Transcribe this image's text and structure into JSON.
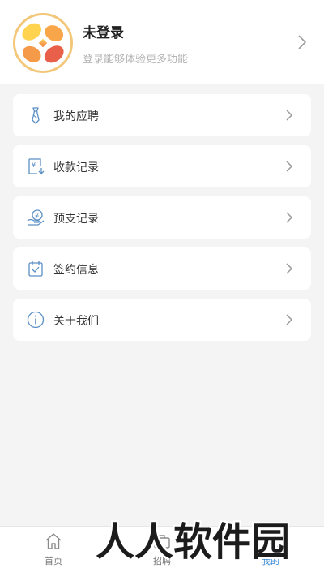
{
  "profile": {
    "name": "未登录",
    "subtitle": "登录能够体验更多功能"
  },
  "menu": [
    {
      "label": "我的应聘",
      "icon": "tie-icon"
    },
    {
      "label": "收款记录",
      "icon": "receipt-yen-icon"
    },
    {
      "label": "预支记录",
      "icon": "hand-yen-icon"
    },
    {
      "label": "签约信息",
      "icon": "calendar-check-icon"
    },
    {
      "label": "关于我们",
      "icon": "info-icon"
    }
  ],
  "tabbar": {
    "home": "首页",
    "jobs": "招聘",
    "mine": "我的",
    "active": "mine"
  },
  "colors": {
    "accent": "#3e8bd6",
    "icon_stroke": "#5a8fc4",
    "avatar_gold": "#f3c77a",
    "avatar_red": "#e86a4a"
  },
  "watermark": "人人软件园"
}
